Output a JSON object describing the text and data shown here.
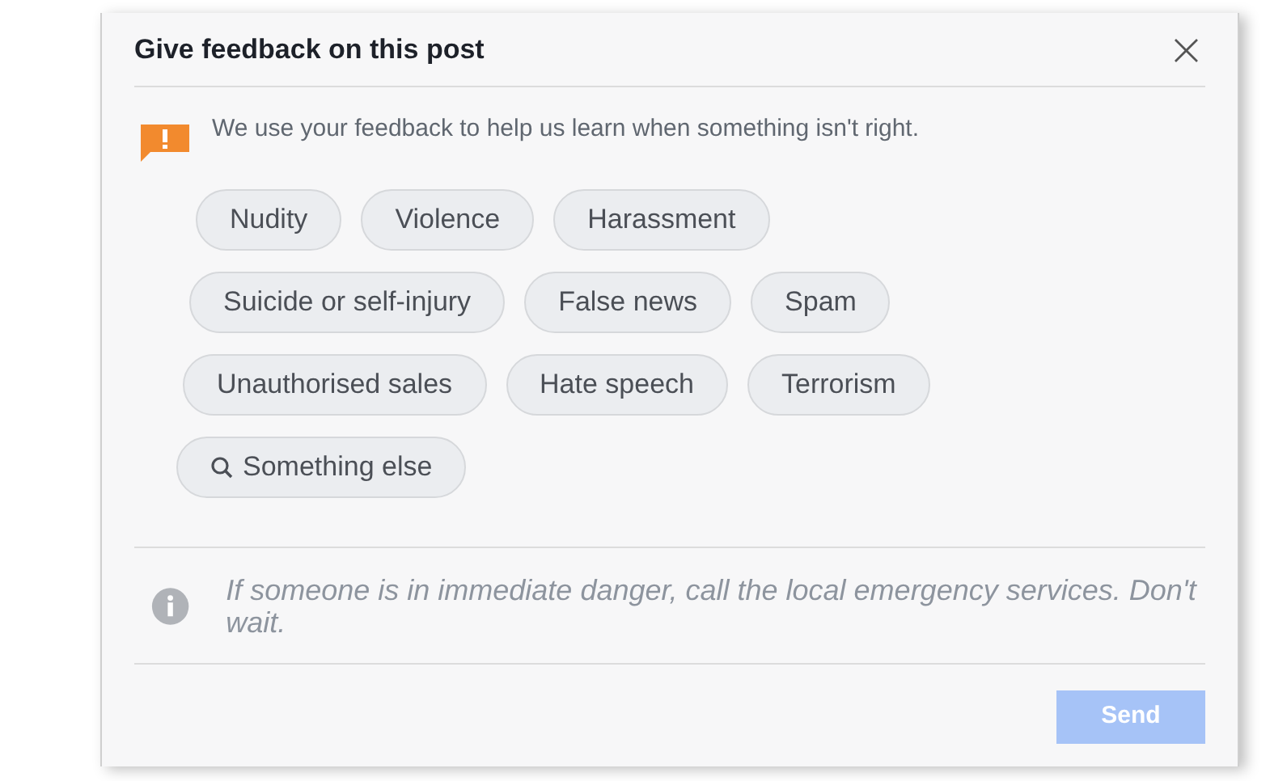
{
  "dialog": {
    "title": "Give feedback on this post",
    "close": "×"
  },
  "notice": "We use your feedback to help us learn when something isn't right.",
  "chip_rows": [
    [
      {
        "label": "Nudity",
        "kind": "plain",
        "selected": false
      },
      {
        "label": "Violence",
        "kind": "plain",
        "selected": false
      },
      {
        "label": "Harassment",
        "kind": "plain",
        "selected": false
      }
    ],
    [
      {
        "label": "Suicide or self-injury",
        "kind": "plain",
        "selected": false
      },
      {
        "label": "False news",
        "kind": "plain",
        "selected": false
      },
      {
        "label": "Spam",
        "kind": "plain",
        "selected": false
      }
    ],
    [
      {
        "label": "Unauthorised sales",
        "kind": "plain",
        "selected": false
      },
      {
        "label": "Hate speech",
        "kind": "plain",
        "selected": false
      },
      {
        "label": "Terrorism",
        "kind": "plain",
        "selected": false
      }
    ],
    [
      {
        "label": "Something else",
        "kind": "search",
        "selected": false
      }
    ]
  ],
  "info": "If someone is in immediate danger, call the local emergency services. Don't wait.",
  "send": {
    "label": "Send",
    "disabled": true
  }
}
